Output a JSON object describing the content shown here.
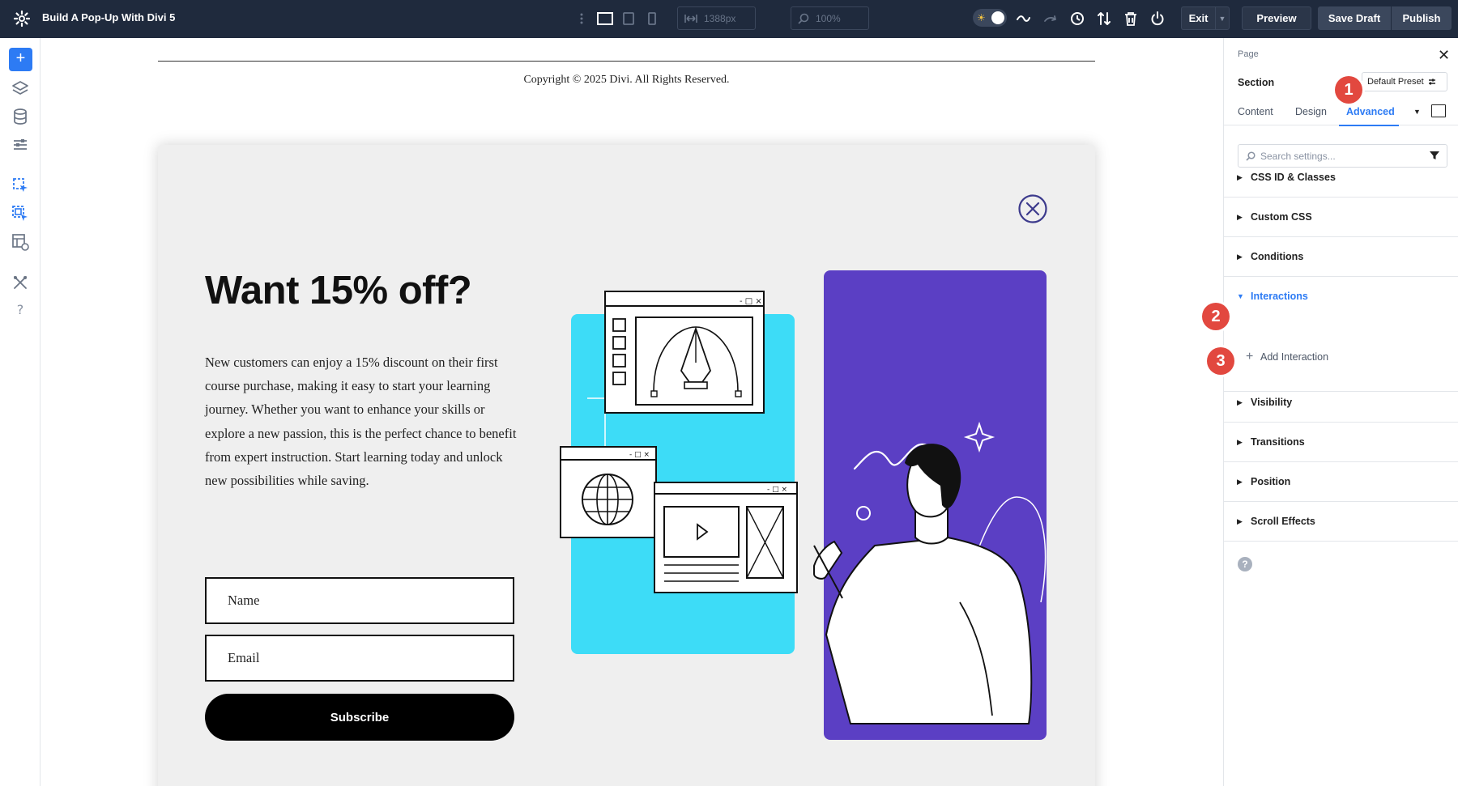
{
  "topbar": {
    "title": "Build A Pop-Up With Divi 5",
    "width_value": "1388px",
    "zoom_value": "100%",
    "exit_label": "Exit",
    "preview_label": "Preview",
    "save_draft_label": "Save Draft",
    "publish_label": "Publish"
  },
  "canvas": {
    "copyright": "Copyright © 2025 Divi. All Rights Reserved.",
    "popup": {
      "headline": "Want 15% off?",
      "body": "New customers can enjoy a 15% discount on their first course purchase, making it easy to start your learning journey. Whether you want to enhance your skills or explore a new passion, this is the perfect chance to benefit from expert instruction. Start learning today and unlock new possibilities while saving.",
      "name_placeholder": "Name",
      "email_placeholder": "Email",
      "subscribe_label": "Subscribe",
      "colors": {
        "cyan_panel": "#3ddcf7",
        "purple_panel": "#5b3fc4"
      }
    }
  },
  "panel": {
    "breadcrumb": "Page",
    "section_label": "Section",
    "preset_label": "Default Preset",
    "tabs": [
      {
        "label": "Content"
      },
      {
        "label": "Design"
      },
      {
        "label": "Advanced"
      }
    ],
    "search_placeholder": "Search settings...",
    "groups": [
      {
        "label": "CSS ID & Classes"
      },
      {
        "label": "Custom CSS"
      },
      {
        "label": "Conditions"
      },
      {
        "label": "Interactions"
      },
      {
        "label": "Visibility"
      },
      {
        "label": "Transitions"
      },
      {
        "label": "Position"
      },
      {
        "label": "Scroll Effects"
      }
    ],
    "add_interaction_label": "Add Interaction",
    "help_glyph": "?"
  },
  "badges": [
    "1",
    "2",
    "3"
  ],
  "colors": {
    "topbar_bg": "#1f2a3d",
    "accent_blue": "#2d7bf4",
    "badge_red": "#e2483f"
  }
}
